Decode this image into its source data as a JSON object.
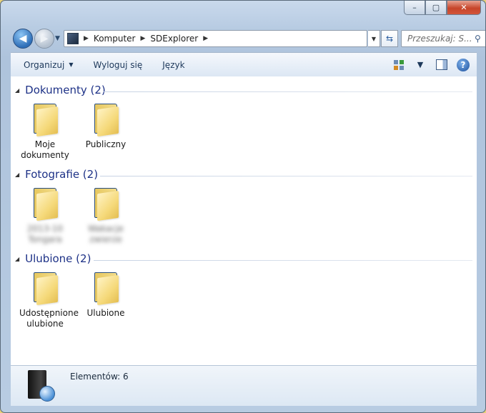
{
  "window": {
    "minimize_glyph": "–",
    "maximize_glyph": "▢",
    "close_glyph": "✕"
  },
  "nav": {
    "back_glyph": "◀",
    "forward_glyph": "▶"
  },
  "address": {
    "crumbs": [
      "Komputer",
      "SDExplorer"
    ]
  },
  "search": {
    "placeholder": "Przeszukaj: S..."
  },
  "toolbar": {
    "organize_label": "Organizuj",
    "logout_label": "Wyloguj się",
    "language_label": "Język"
  },
  "groups": [
    {
      "title": "Dokumenty (2)",
      "items": [
        {
          "label": "Moje dokumenty"
        },
        {
          "label": "Publiczny"
        }
      ]
    },
    {
      "title": "Fotografie (2)",
      "items": [
        {
          "label": "2013-10 Tongara"
        },
        {
          "label": "Wakacje zwierze"
        }
      ]
    },
    {
      "title": "Ulubione (2)",
      "items": [
        {
          "label": "Udostępnione ulubione"
        },
        {
          "label": "Ulubione"
        }
      ]
    }
  ],
  "status": {
    "count_text": "Elementów: 6"
  },
  "colors": {
    "group_title": "#1e3287",
    "toolbar_text": "#1e395b",
    "folder": "#f2d77e"
  }
}
